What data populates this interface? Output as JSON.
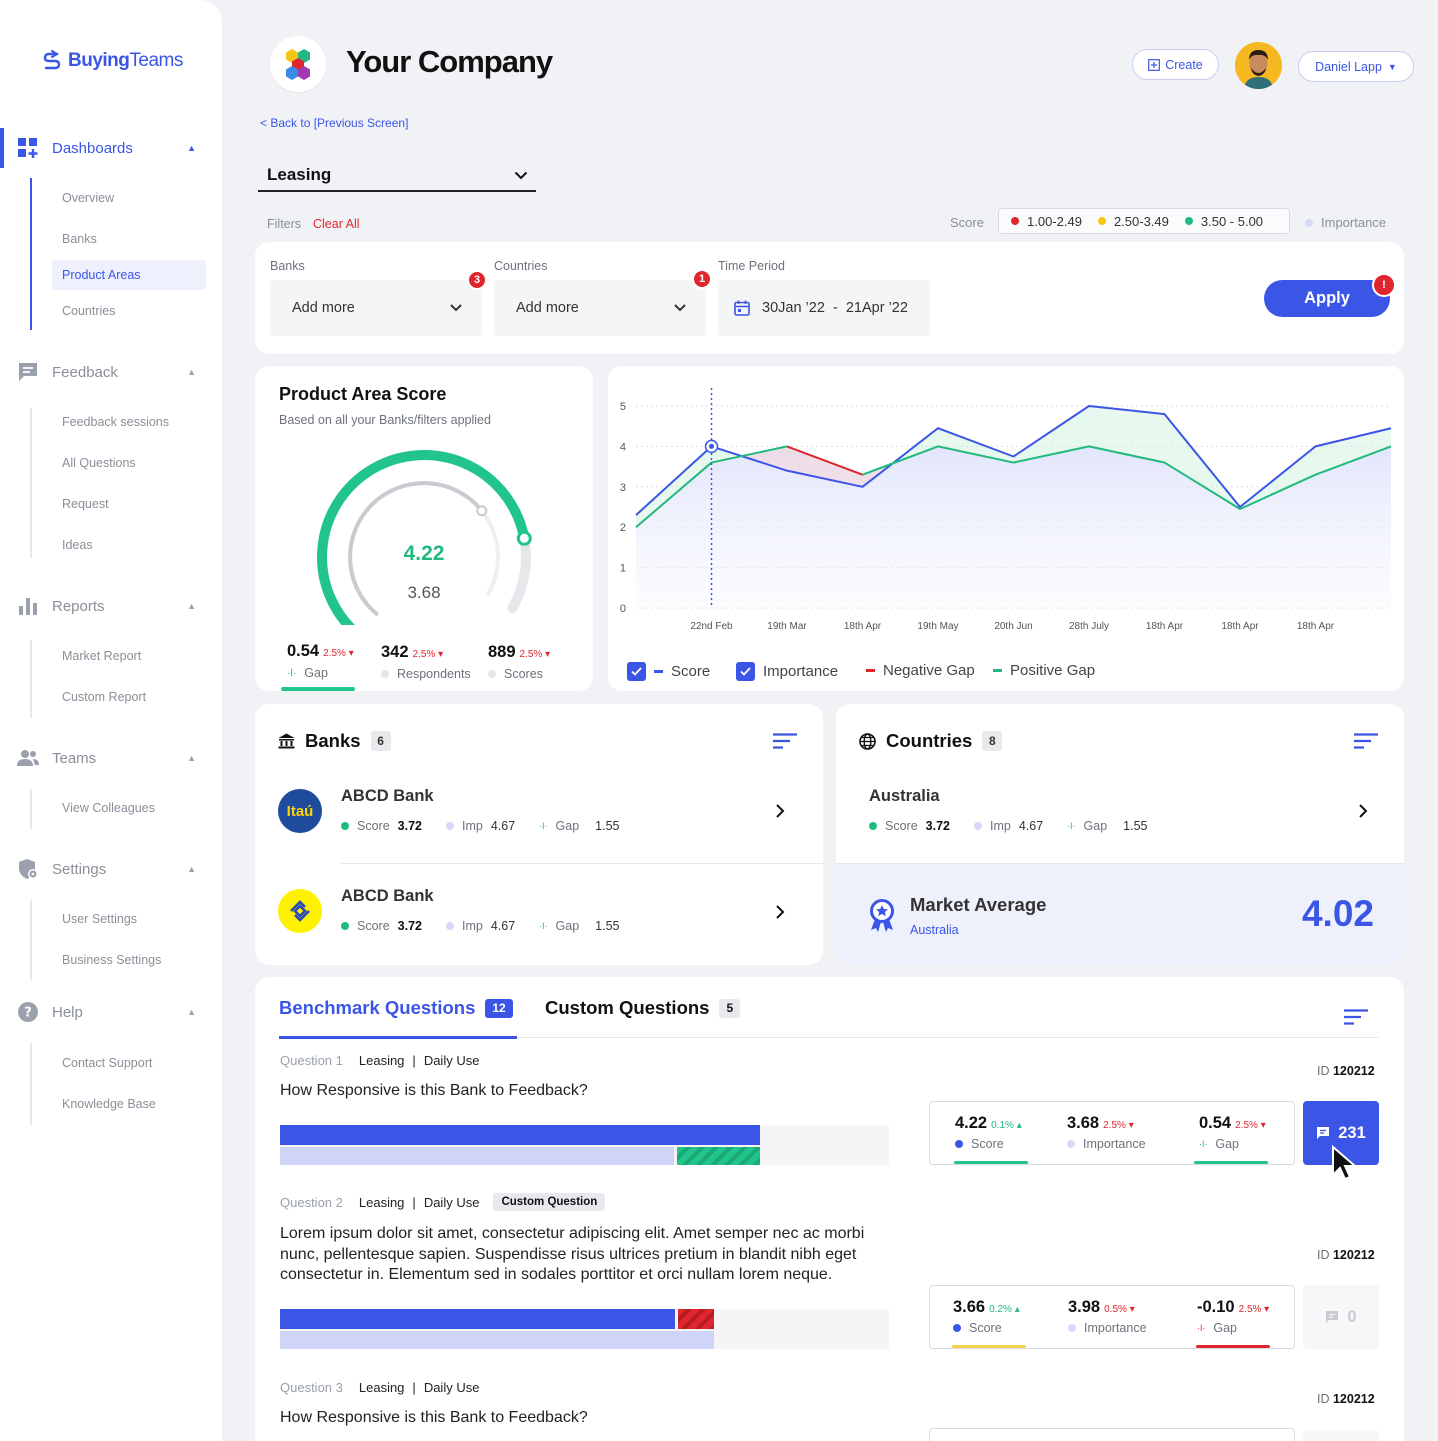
{
  "brand": {
    "name_bold": "Buying",
    "name_light": "Teams"
  },
  "sidebar": {
    "dashboards": {
      "label": "Dashboards",
      "items": [
        "Overview",
        "Banks",
        "Product Areas",
        "Countries"
      ]
    },
    "feedback": {
      "label": "Feedback",
      "items": [
        "Feedback sessions",
        "All Questions",
        "Request",
        "Ideas"
      ]
    },
    "reports": {
      "label": "Reports",
      "items": [
        "Market Report",
        "Custom Report"
      ]
    },
    "teams": {
      "label": "Teams",
      "items": [
        "View Colleagues"
      ]
    },
    "settings": {
      "label": "Settings",
      "items": [
        "User Settings",
        "Business Settings"
      ]
    },
    "help": {
      "label": "Help",
      "items": [
        "Contact Support",
        "Knowledge Base"
      ]
    }
  },
  "header": {
    "company": "Your Company",
    "create": "Create",
    "user": "Daniel Lapp",
    "back": "< Back to [Previous Screen]"
  },
  "area_select": {
    "value": "Leasing"
  },
  "filters": {
    "label": "Filters",
    "clear": "Clear All",
    "score_label": "Score",
    "score_legend": [
      {
        "label": "1.00-2.49",
        "color": "#e0262d"
      },
      {
        "label": "2.50-3.49",
        "color": "#f5c518"
      },
      {
        "label": "3.50 - 5.00",
        "color": "#21b97d"
      }
    ],
    "importance_label": "Importance",
    "banks": {
      "label": "Banks",
      "value": "Add more",
      "badge": "3"
    },
    "countries": {
      "label": "Countries",
      "value": "Add more",
      "badge": "1"
    },
    "period": {
      "label": "Time Period",
      "value": "30Jan ’22  -  21Apr ’22"
    },
    "apply": "Apply",
    "apply_badge": "!"
  },
  "score_card": {
    "title": "Product Area Score",
    "subtitle": "Based on all your Banks/filters applied",
    "score": "4.22",
    "importance": "3.68",
    "score_fraction": 0.844,
    "importance_fraction": 0.736,
    "metrics": [
      {
        "value": "0.54",
        "change": "2.5%",
        "label": "Gap"
      },
      {
        "value": "342",
        "change": "2.5%",
        "label": "Respondents"
      },
      {
        "value": "889",
        "change": "2.5%",
        "label": "Scores"
      }
    ]
  },
  "chart_data": {
    "type": "line",
    "x": [
      "",
      "22nd Feb",
      "19th Mar",
      "18th Apr",
      "19th May",
      "20th Jun",
      "28th July",
      "18th Apr",
      "18th Apr",
      "18th Apr",
      ""
    ],
    "series": [
      {
        "name": "Score",
        "color": "#3b55e6",
        "values": [
          2.3,
          4.0,
          3.4,
          3.0,
          4.45,
          3.75,
          5.0,
          4.8,
          2.5,
          4.0,
          4.45
        ]
      },
      {
        "name": "Importance",
        "color": "#21b97d",
        "values": [
          2.0,
          3.6,
          4.0,
          3.3,
          4.0,
          3.6,
          4.0,
          3.6,
          2.45,
          3.3,
          4.0
        ]
      }
    ],
    "ylim": [
      0,
      5
    ],
    "yticks": [
      "0",
      "1",
      "2",
      "3",
      "4",
      "5"
    ],
    "legend": [
      "Score",
      "Importance",
      "Negative Gap",
      "Positive Gap"
    ],
    "grid": true
  },
  "banks": {
    "title": "Banks",
    "count": "6",
    "rows": [
      {
        "name": "ABCD Bank",
        "logo": "Itaú",
        "score": "3.72",
        "imp": "4.67",
        "gap": "1.55"
      },
      {
        "name": "ABCD Bank",
        "logo": "",
        "score": "3.72",
        "imp": "4.67",
        "gap": "1.55"
      }
    ]
  },
  "countries": {
    "title": "Countries",
    "count": "8",
    "rows": [
      {
        "name": "Australia",
        "score": "3.72",
        "imp": "4.67",
        "gap": "1.55"
      }
    ],
    "market": {
      "title": "Market Average",
      "sub": "Australia",
      "value": "4.02"
    }
  },
  "stat_labels": {
    "score": "Score",
    "imp": "Imp",
    "gap": "Gap",
    "importance": "Importance"
  },
  "questions": {
    "tabs": [
      {
        "label": "Benchmark Questions",
        "count": "12"
      },
      {
        "label": "Custom Questions",
        "count": "5"
      }
    ],
    "id_label": "ID",
    "items": [
      {
        "num": "Question 1",
        "area": "Leasing",
        "use": "Daily Use",
        "tag": "",
        "id": "120212",
        "text": "How Responsive is this Bank to Feedback?",
        "score": "4.22",
        "score_chg": "0.1%",
        "imp": "3.68",
        "imp_chg": "2.5%",
        "gap": "0.54",
        "gap_chg": "2.5%",
        "comments": "231"
      },
      {
        "num": "Question 2",
        "area": "Leasing",
        "use": "Daily Use",
        "tag": "Custom Question",
        "id": "120212",
        "text": "Lorem ipsum dolor sit amet, consectetur adipiscing elit. Amet semper nec ac morbi nunc, pellentesque sapien. Suspendisse risus ultrices pretium in blandit nibh eget consectetur in. Elementum sed in sodales porttitor et orci nullam lorem neque.",
        "score": "3.66",
        "score_chg": "0.2%",
        "imp": "3.98",
        "imp_chg": "0.5%",
        "gap": "-0.10",
        "gap_chg": "2.5%",
        "comments": "0"
      },
      {
        "num": "Question 3",
        "area": "Leasing",
        "use": "Daily Use",
        "tag": "",
        "id": "120212",
        "text": "How Responsive is this Bank to Feedback?"
      }
    ]
  }
}
